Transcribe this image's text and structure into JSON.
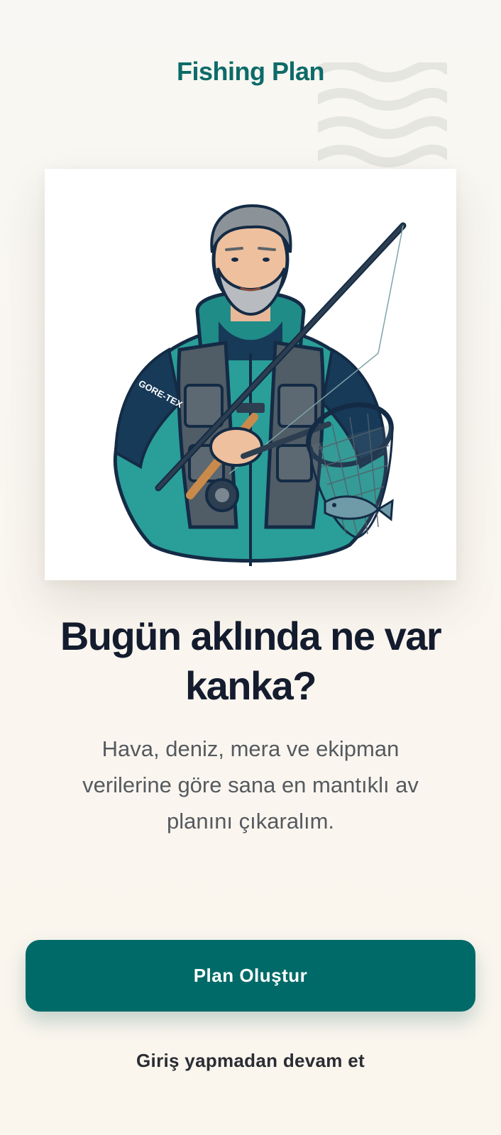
{
  "app": {
    "title": "Fishing Plan"
  },
  "hero": {
    "illustration": "fisherman-illustration",
    "jacket_brand": "GORE-TEX"
  },
  "welcome": {
    "headline_line1": "Bugün aklında ne var",
    "headline_line2": "kanka?",
    "subtext_line1": "Hava, deniz, mera ve ekipman",
    "subtext_line2": "verilerine göre sana en mantıklı av",
    "subtext_line3": "planını çıkaralım."
  },
  "actions": {
    "primary_label": "Plan Oluştur",
    "secondary_label": "Giriş yapmadan devam et"
  },
  "colors": {
    "accent": "#006a68",
    "title": "#0d6b68",
    "headline": "#141c2e",
    "body_text": "#555a60",
    "background": "#f9f6f0"
  }
}
